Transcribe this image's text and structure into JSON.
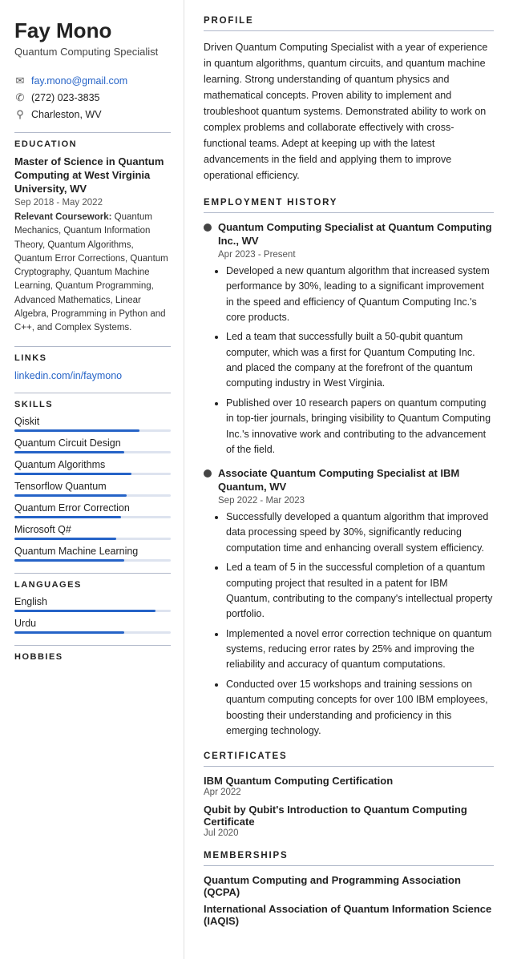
{
  "sidebar": {
    "name": "Fay Mono",
    "title": "Quantum Computing Specialist",
    "contact": {
      "email": "fay.mono@gmail.com",
      "phone": "(272) 023-3835",
      "location": "Charleston, WV"
    },
    "education": {
      "section_title": "EDUCATION",
      "degree": "Master of Science in Quantum Computing at West Virginia University, WV",
      "date": "Sep 2018 - May 2022",
      "coursework_label": "Relevant Coursework:",
      "coursework": "Quantum Mechanics, Quantum Information Theory, Quantum Algorithms, Quantum Error Corrections, Quantum Cryptography, Quantum Machine Learning, Quantum Programming, Advanced Mathematics, Linear Algebra, Programming in Python and C++, and Complex Systems."
    },
    "links": {
      "section_title": "LINKS",
      "items": [
        {
          "label": "linkedin.com/in/faymono",
          "url": "#"
        }
      ]
    },
    "skills": {
      "section_title": "SKILLS",
      "items": [
        {
          "name": "Qiskit",
          "pct": 80
        },
        {
          "name": "Quantum Circuit Design",
          "pct": 70
        },
        {
          "name": "Quantum Algorithms",
          "pct": 75
        },
        {
          "name": "Tensorflow Quantum",
          "pct": 72
        },
        {
          "name": "Quantum Error Correction",
          "pct": 68
        },
        {
          "name": "Microsoft Q#",
          "pct": 65
        },
        {
          "name": "Quantum Machine Learning",
          "pct": 70
        }
      ]
    },
    "languages": {
      "section_title": "LANGUAGES",
      "items": [
        {
          "name": "English",
          "pct": 90
        },
        {
          "name": "Urdu",
          "pct": 70
        }
      ]
    },
    "hobbies": {
      "section_title": "HOBBIES"
    }
  },
  "main": {
    "profile": {
      "section_title": "PROFILE",
      "text": "Driven Quantum Computing Specialist with a year of experience in quantum algorithms, quantum circuits, and quantum machine learning. Strong understanding of quantum physics and mathematical concepts. Proven ability to implement and troubleshoot quantum systems. Demonstrated ability to work on complex problems and collaborate effectively with cross-functional teams. Adept at keeping up with the latest advancements in the field and applying them to improve operational efficiency."
    },
    "employment": {
      "section_title": "EMPLOYMENT HISTORY",
      "jobs": [
        {
          "title": "Quantum Computing Specialist at Quantum Computing Inc., WV",
          "date": "Apr 2023 - Present",
          "bullets": [
            "Developed a new quantum algorithm that increased system performance by 30%, leading to a significant improvement in the speed and efficiency of Quantum Computing Inc.'s core products.",
            "Led a team that successfully built a 50-qubit quantum computer, which was a first for Quantum Computing Inc. and placed the company at the forefront of the quantum computing industry in West Virginia.",
            "Published over 10 research papers on quantum computing in top-tier journals, bringing visibility to Quantum Computing Inc.'s innovative work and contributing to the advancement of the field."
          ]
        },
        {
          "title": "Associate Quantum Computing Specialist at IBM Quantum, WV",
          "date": "Sep 2022 - Mar 2023",
          "bullets": [
            "Successfully developed a quantum algorithm that improved data processing speed by 30%, significantly reducing computation time and enhancing overall system efficiency.",
            "Led a team of 5 in the successful completion of a quantum computing project that resulted in a patent for IBM Quantum, contributing to the company's intellectual property portfolio.",
            "Implemented a novel error correction technique on quantum systems, reducing error rates by 25% and improving the reliability and accuracy of quantum computations.",
            "Conducted over 15 workshops and training sessions on quantum computing concepts for over 100 IBM employees, boosting their understanding and proficiency in this emerging technology."
          ]
        }
      ]
    },
    "certificates": {
      "section_title": "CERTIFICATES",
      "items": [
        {
          "name": "IBM Quantum Computing Certification",
          "date": "Apr 2022"
        },
        {
          "name": "Qubit by Qubit's Introduction to Quantum Computing Certificate",
          "date": "Jul 2020"
        }
      ]
    },
    "memberships": {
      "section_title": "MEMBERSHIPS",
      "items": [
        {
          "name": "Quantum Computing and Programming Association (QCPA)"
        },
        {
          "name": "International Association of Quantum Information Science (IAQIS)"
        }
      ]
    }
  }
}
